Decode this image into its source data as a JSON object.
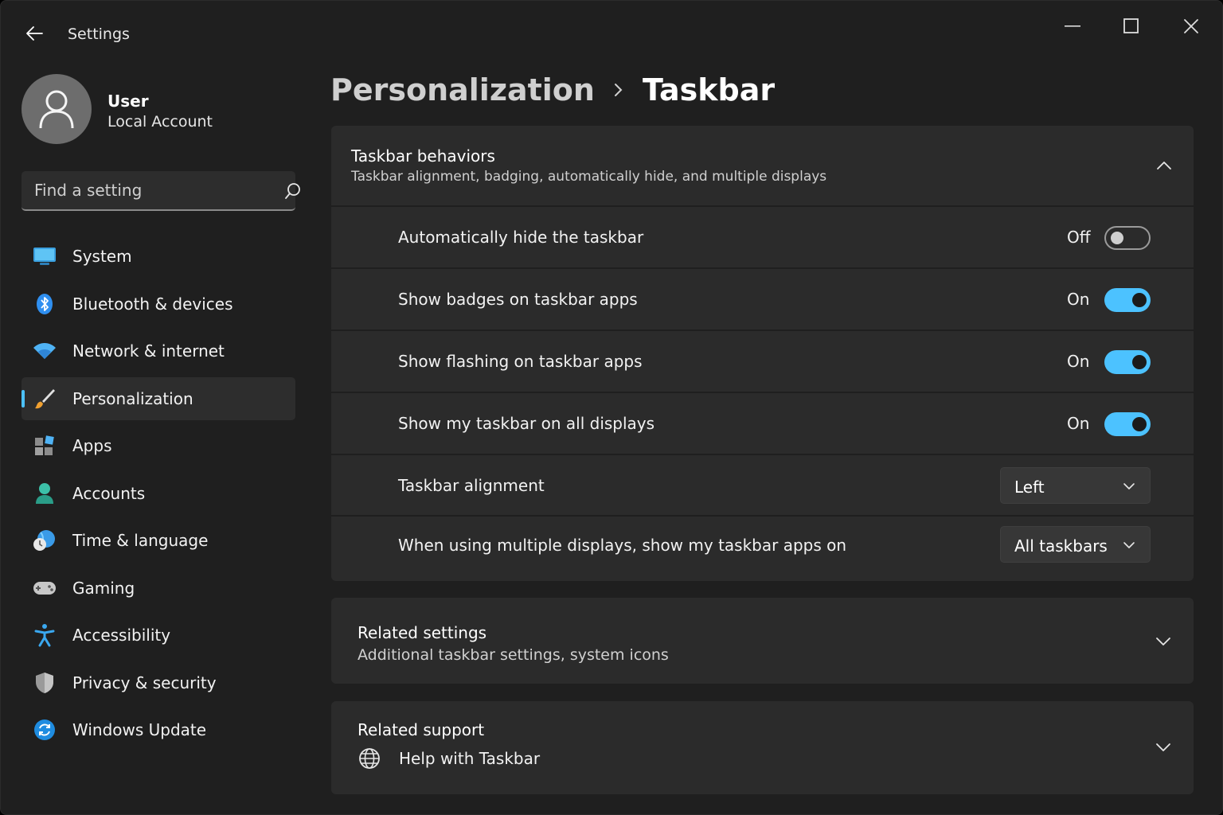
{
  "window": {
    "title": "Settings"
  },
  "profile": {
    "name": "User",
    "account_type": "Local Account"
  },
  "search": {
    "placeholder": "Find a setting"
  },
  "nav": {
    "items": [
      {
        "label": "System",
        "icon": "monitor-icon"
      },
      {
        "label": "Bluetooth & devices",
        "icon": "bluetooth-icon"
      },
      {
        "label": "Network & internet",
        "icon": "wifi-icon"
      },
      {
        "label": "Personalization",
        "icon": "paintbrush-icon",
        "active": true
      },
      {
        "label": "Apps",
        "icon": "apps-icon"
      },
      {
        "label": "Accounts",
        "icon": "person-icon"
      },
      {
        "label": "Time & language",
        "icon": "globe-clock-icon"
      },
      {
        "label": "Gaming",
        "icon": "gamepad-icon"
      },
      {
        "label": "Accessibility",
        "icon": "accessibility-icon"
      },
      {
        "label": "Privacy & security",
        "icon": "shield-icon"
      },
      {
        "label": "Windows Update",
        "icon": "update-icon"
      }
    ]
  },
  "breadcrumb": {
    "parent": "Personalization",
    "current": "Taskbar"
  },
  "behaviors": {
    "title": "Taskbar behaviors",
    "subtitle": "Taskbar alignment, badging, automatically hide, and multiple displays",
    "rows": [
      {
        "label": "Automatically hide the taskbar",
        "state": "Off",
        "on": false
      },
      {
        "label": "Show badges on taskbar apps",
        "state": "On",
        "on": true
      },
      {
        "label": "Show flashing on taskbar apps",
        "state": "On",
        "on": true
      },
      {
        "label": "Show my taskbar on all displays",
        "state": "On",
        "on": true
      }
    ],
    "alignment": {
      "label": "Taskbar alignment",
      "value": "Left"
    },
    "multi_display": {
      "label": "When using multiple displays, show my taskbar apps on",
      "value": "All taskbars"
    }
  },
  "related_settings": {
    "title": "Related settings",
    "subtitle": "Additional taskbar settings, system icons"
  },
  "related_support": {
    "title": "Related support",
    "help_label": "Help with Taskbar"
  },
  "colors": {
    "accent": "#4cc2ff",
    "background": "#1f1f1f",
    "card": "#2b2b2b"
  }
}
